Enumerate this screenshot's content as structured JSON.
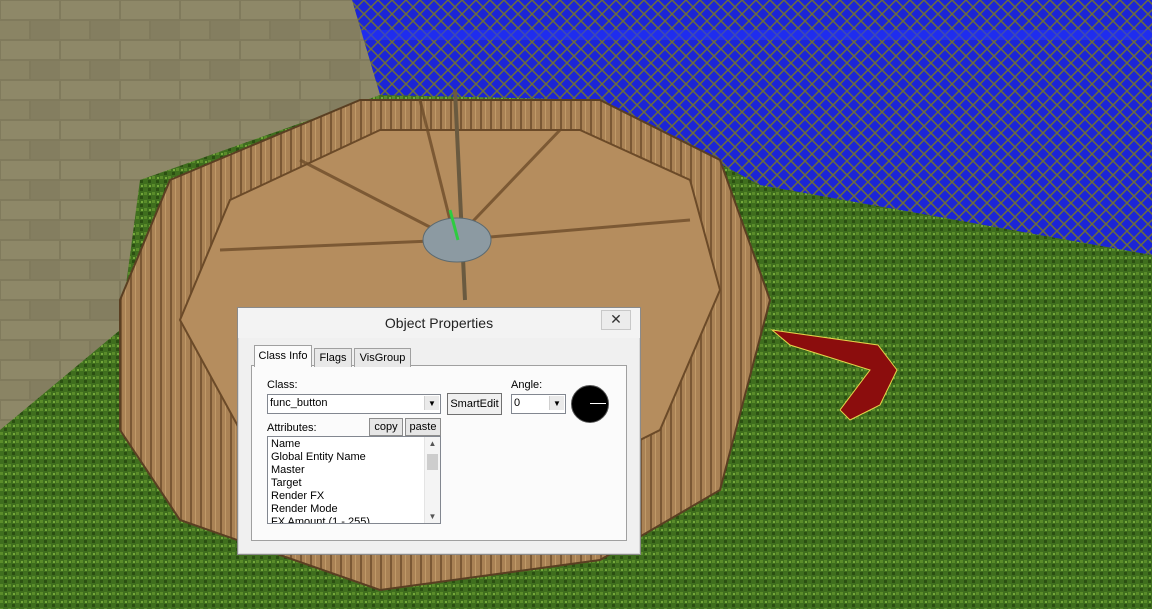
{
  "dialog": {
    "title": "Object Properties",
    "close_glyph": "✕",
    "tabs": [
      {
        "label": "Class Info",
        "active": true
      },
      {
        "label": "Flags",
        "active": false
      },
      {
        "label": "VisGroup",
        "active": false
      }
    ],
    "class_label": "Class:",
    "class_value": "func_button",
    "smartedit_label": "SmartEdit",
    "angle_label": "Angle:",
    "angle_value": "0",
    "attributes_label": "Attributes:",
    "copy_label": "copy",
    "paste_label": "paste",
    "attributes": [
      "Name",
      "Global Entity Name",
      "Master",
      "Target",
      "Render FX",
      "Render Mode",
      "FX Amount (1 - 255)"
    ]
  },
  "icons": {
    "dropdown": "chevron-down-icon",
    "scroll_up": "scroll-up-icon",
    "scroll_down": "scroll-down-icon",
    "angle_dial": "angle-dial-icon",
    "close": "close-icon"
  },
  "colors": {
    "dialog_bg": "#f0f0f0",
    "grass": "#3c6a1c",
    "wall_blue": "#1a2be0",
    "wood": "#a07a48",
    "selection_red": "#8b0d0d"
  }
}
